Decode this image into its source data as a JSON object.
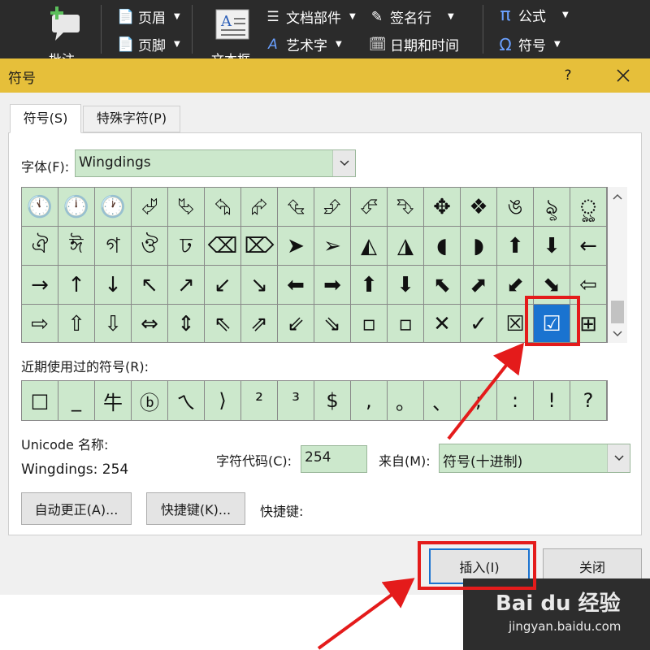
{
  "ribbon": {
    "comment_label": "批注",
    "header_label": "页眉",
    "footer_label": "页脚",
    "textbox_label": "文本框",
    "doc_parts_label": "文档部件",
    "wordart_label": "艺术字",
    "signature_label": "签名行",
    "datetime_label": "日期和时间",
    "equation_label": "公式",
    "symbol_label": "符号"
  },
  "dialog": {
    "title": "符号",
    "help": "?",
    "tabs": [
      "符号(S)",
      "特殊字符(P)"
    ],
    "font_label": "字体(F):",
    "font_value": "Wingdings",
    "recent_label": "近期使用过的符号(R):",
    "unicode_name_label": "Unicode 名称:",
    "unicode_name_value": "Wingdings: 254",
    "char_code_label": "字符代码(C):",
    "char_code_value": "254",
    "from_label": "来自(M):",
    "from_value": "符号(十进制)",
    "autocorrect_button": "自动更正(A)...",
    "shortcut_button": "快捷键(K)...",
    "shortcut_label": "快捷键:",
    "insert_button": "插入(I)",
    "close_button": "关闭"
  },
  "symbol_grid": {
    "selected_row": 3,
    "selected_col": 14,
    "rows": [
      [
        "🕚",
        "🕛",
        "🕐",
        "⮰",
        "⮱",
        "⮲",
        "⮳",
        "⮴",
        "⮵",
        "⮶",
        "⮷",
        "✥",
        "❖",
        "ঙ",
        "ৡ",
        "ৣ"
      ],
      [
        "ঐ",
        "ঈ",
        "গ",
        "ঔ",
        "ঢ",
        "⌫",
        "⌦",
        "➤",
        "➢",
        "◭",
        "◮",
        "◖",
        "◗",
        "⬆",
        "⬇",
        "←"
      ],
      [
        "→",
        "↑",
        "↓",
        "↖",
        "↗",
        "↙",
        "↘",
        "⬅",
        "➡",
        "⬆",
        "⬇",
        "⬉",
        "⬈",
        "⬋",
        "⬊",
        "⇦"
      ],
      [
        "⇨",
        "⇧",
        "⇩",
        "⇔",
        "⇕",
        "⇖",
        "⇗",
        "⇙",
        "⇘",
        "▫",
        "▫",
        "✕",
        "✓",
        "☒",
        "☑",
        "⊞"
      ]
    ]
  },
  "recent_symbols": [
    "□",
    "_",
    "牛",
    "ⓑ",
    "ㄟ",
    "⟩",
    "²",
    "³",
    "$",
    ",",
    "。",
    "、",
    ";",
    ":",
    "!",
    "?"
  ],
  "watermark": {
    "brand": "Bai du 经验",
    "url": "jingyan.baidu.com"
  },
  "colors": {
    "title_bar": "#e6bf3a",
    "grid_bg": "#cce8cc",
    "selection": "#1a73d0",
    "annotation_red": "#e41b1b"
  }
}
